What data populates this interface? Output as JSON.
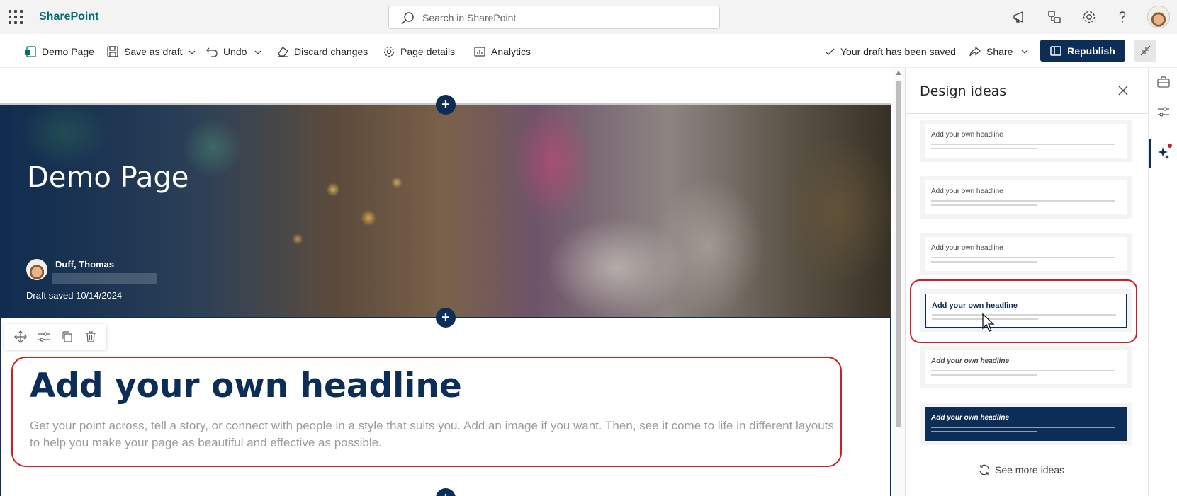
{
  "app": {
    "name": "SharePoint"
  },
  "search": {
    "placeholder": "Search in SharePoint"
  },
  "icons": {
    "waffle": "app-launcher-icon",
    "search": "search-icon",
    "megaphone": "megaphone-icon",
    "share_toggle": "share-toggle-icon",
    "settings": "gear-icon",
    "help": "help-icon"
  },
  "commands": {
    "page": "Demo Page",
    "save": "Save as draft",
    "undo": "Undo",
    "discard": "Discard changes",
    "details": "Page details",
    "analytics": "Analytics",
    "status": "Your draft has been saved",
    "share": "Share",
    "republish": "Republish"
  },
  "hero": {
    "title": "Demo Page",
    "author": "Duff, Thomas",
    "draft": "Draft saved 10/14/2024"
  },
  "content": {
    "headline": "Add your own headline",
    "body": "Get your point across, tell a story, or connect with people in a style that suits you. Add an image if you want. Then, see it come to life in different layouts to help you make your page as beautiful and effective as possible."
  },
  "panel": {
    "title": "Design ideas",
    "ideas": [
      {
        "headline": "Add your own headline"
      },
      {
        "headline": "Add your own headline"
      },
      {
        "headline": "Add your own headline"
      },
      {
        "headline": "Add your own headline"
      },
      {
        "headline": "Add your own headline"
      },
      {
        "headline": "Add your own headline"
      }
    ],
    "more": "See more ideas"
  },
  "colors": {
    "brand": "#036c70",
    "primary": "#0c2d55",
    "highlight": "#d01f23"
  }
}
